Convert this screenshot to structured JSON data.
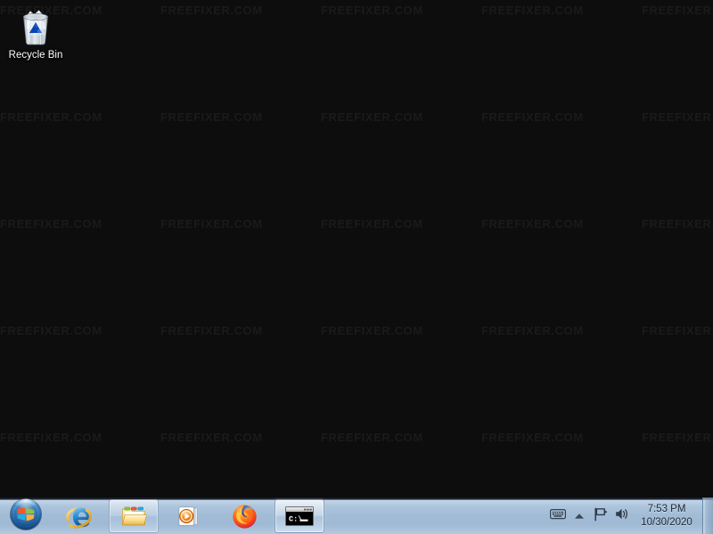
{
  "desktop": {
    "background_color": "#0d0d0d",
    "watermark": {
      "text": "FREEFIXER.COM",
      "color": "#1d1d1d",
      "columns_x": [
        0,
        180,
        360,
        540,
        720
      ],
      "rows_y": [
        4,
        124,
        244,
        364,
        484
      ]
    },
    "icons": [
      {
        "name": "recycle-bin",
        "label": "Recycle Bin",
        "icon": "recycle-bin-icon"
      }
    ]
  },
  "taskbar": {
    "background_color": "#a8c0db",
    "start_button": {
      "label": "Start",
      "icon": "windows-orb-icon"
    },
    "buttons": [
      {
        "name": "internet-explorer",
        "label": "Internet Explorer",
        "icon": "internet-explorer-icon",
        "state": "pinned"
      },
      {
        "name": "windows-explorer",
        "label": "Windows Explorer",
        "icon": "folder-icon",
        "state": "pinned-active"
      },
      {
        "name": "windows-media-player",
        "label": "Windows Media Player",
        "icon": "media-player-icon",
        "state": "pinned"
      },
      {
        "name": "firefox",
        "label": "Mozilla Firefox",
        "icon": "firefox-icon",
        "state": "pinned"
      },
      {
        "name": "command-prompt",
        "label": "Command Prompt",
        "icon": "command-prompt-icon",
        "state": "window-open"
      }
    ],
    "tray": {
      "icons": [
        {
          "name": "input-indicator",
          "label": "Input Indicator",
          "icon": "keyboard-icon"
        },
        {
          "name": "show-hidden-icons",
          "label": "Show hidden icons",
          "icon": "chevron-up-icon"
        },
        {
          "name": "action-center",
          "label": "Action Center",
          "icon": "flag-icon"
        },
        {
          "name": "volume",
          "label": "Volume",
          "icon": "speaker-icon"
        }
      ],
      "clock": {
        "time": "7:53 PM",
        "date": "10/30/2020"
      },
      "show_desktop": {
        "label": "Show desktop"
      }
    }
  }
}
